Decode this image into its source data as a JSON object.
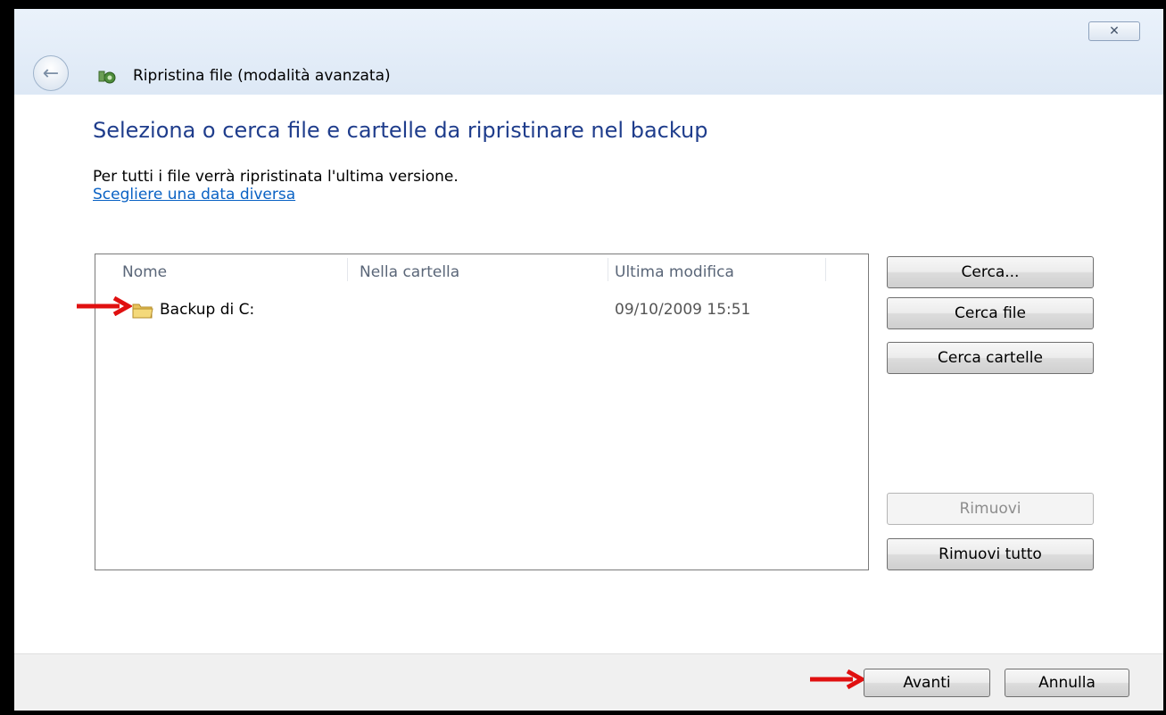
{
  "window": {
    "title": "Ripristina file (modalità avanzata)",
    "close_glyph": "✕"
  },
  "content": {
    "heading": "Seleziona o cerca file e cartelle da ripristinare nel backup",
    "info": "Per tutti i file verrà ripristinata l'ultima versione.",
    "date_link": "Scegliere una data diversa"
  },
  "list": {
    "columns": [
      "Nome",
      "Nella cartella",
      "Ultima modifica"
    ],
    "rows": [
      {
        "name": "Backup di C:",
        "folder": "",
        "modified": "09/10/2009 15:51",
        "icon": "folder-icon"
      }
    ]
  },
  "side_buttons": {
    "search": "Cerca...",
    "search_files": "Cerca file",
    "search_folders": "Cerca cartelle",
    "remove": "Rimuovi",
    "remove_all": "Rimuovi tutto"
  },
  "footer": {
    "next": "Avanti",
    "cancel": "Annulla"
  },
  "annotation": {
    "arrow_color": "#e01010",
    "arrow_icon": "right-arrow-icon"
  },
  "colors": {
    "heading": "#1f3d8c",
    "link": "#0a62c4"
  }
}
